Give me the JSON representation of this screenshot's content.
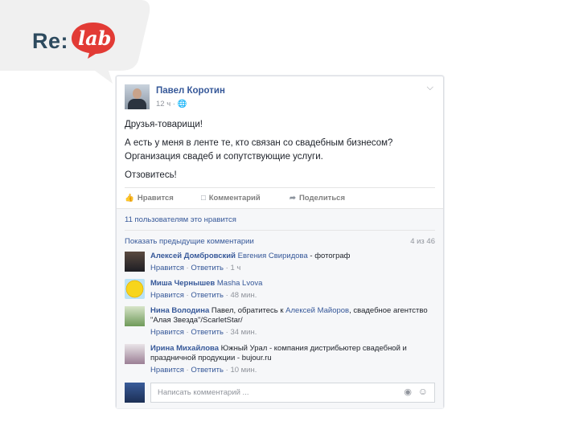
{
  "logo": {
    "re": "Re:",
    "lab": "lab"
  },
  "post": {
    "author": "Павел Коротин",
    "meta": "12 ч · ",
    "lines": [
      "Друзья-товарищи!",
      "А есть у меня в ленте те, кто связан со свадебным бизнесом?",
      "Организация свадеб и сопутствующие услуги.",
      "Отзовитесь!"
    ],
    "actions": {
      "like": "Нравится",
      "comment": "Комментарий",
      "share": "Поделиться"
    }
  },
  "likes_text": "11 пользователям это нравится",
  "prev_comments": "Показать предыдущие комментарии",
  "comment_count": "4 из 46",
  "comments": [
    {
      "name": "Алексей Домбровский",
      "mention": "Евгения Свиридова",
      "text": " - фотограф",
      "sub_like": "Нравится",
      "sub_reply": "Ответить",
      "sub_time": "1 ч"
    },
    {
      "name": "Миша Чернышев",
      "mention": "Masha Lvova",
      "text": "",
      "sub_like": "Нравится",
      "sub_reply": "Ответить",
      "sub_time": "48 мин."
    },
    {
      "name": "Нина Володина",
      "text_a": " Павел, обратитесь к ",
      "mention": "Алексей Майоров",
      "text_b": ", свадебное агентство \"Алая Звезда\"/ScarletStar/",
      "sub_like": "Нравится",
      "sub_reply": "Ответить",
      "sub_time": "34 мин."
    },
    {
      "name": "Ирина Михайлова",
      "text": " Южный Урал - компания дистрибьютер свадебной и праздничной продукции - bujour.ru",
      "sub_like": "Нравится",
      "sub_reply": "Ответить",
      "sub_time": "10 мин."
    }
  ],
  "write_placeholder": "Написать комментарий ..."
}
